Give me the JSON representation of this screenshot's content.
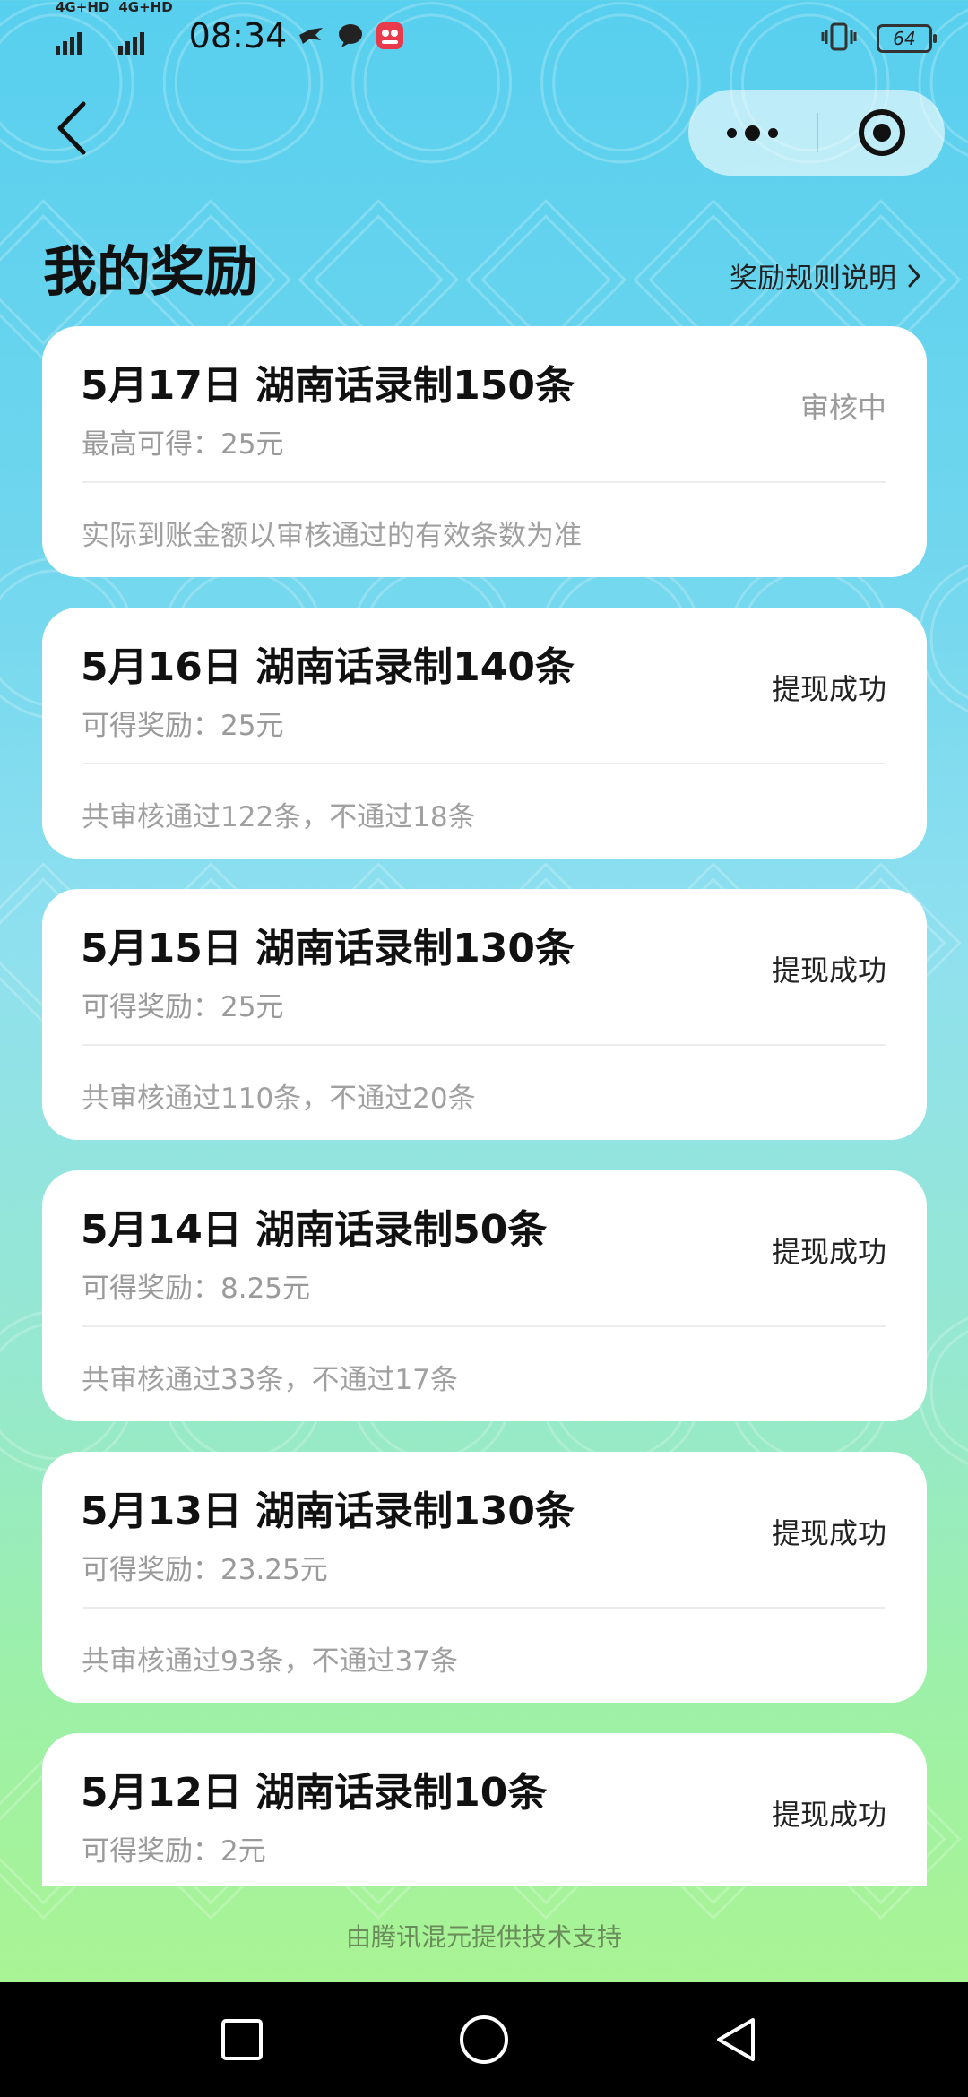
{
  "status_bar": {
    "network_1": "4G+HD",
    "network_2": "4G+HD",
    "time": "08:34",
    "battery": "64"
  },
  "header": {
    "title": "我的奖励",
    "rules_link": "奖励规则说明"
  },
  "records": [
    {
      "title": "5月17日 湖南话录制150条",
      "reward": "最高可得：25元",
      "status": "审核中",
      "note": "实际到账金额以审核通过的有效条数为准"
    },
    {
      "title": "5月16日 湖南话录制140条",
      "reward": "可得奖励：25元",
      "status": "提现成功",
      "note": "共审核通过122条，不通过18条"
    },
    {
      "title": "5月15日 湖南话录制130条",
      "reward": "可得奖励：25元",
      "status": "提现成功",
      "note": "共审核通过110条，不通过20条"
    },
    {
      "title": "5月14日 湖南话录制50条",
      "reward": "可得奖励：8.25元",
      "status": "提现成功",
      "note": "共审核通过33条，不通过17条"
    },
    {
      "title": "5月13日 湖南话录制130条",
      "reward": "可得奖励：23.25元",
      "status": "提现成功",
      "note": "共审核通过93条，不通过37条"
    },
    {
      "title": "5月12日 湖南话录制10条",
      "reward": "可得奖励：2元",
      "status": "提现成功",
      "note": ""
    }
  ],
  "footer": "由腾讯混元提供技术支持",
  "icons": {
    "back": "chevron-left-icon",
    "more": "more-dots-icon",
    "close_target": "target-icon",
    "rules_arrow": "chevron-right-icon"
  },
  "colors": {
    "pending_status": "#9a9a9a",
    "done_status": "#222222",
    "card_bg": "#ffffff"
  }
}
